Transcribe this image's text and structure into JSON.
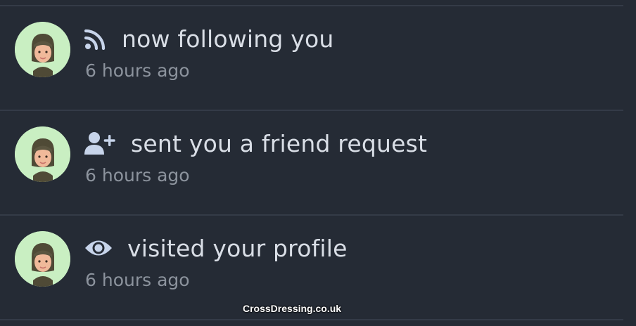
{
  "notifications": [
    {
      "icon": "rss-icon",
      "message": "now following you",
      "time": "6 hours ago"
    },
    {
      "icon": "user-plus-icon",
      "message": "sent you a friend request",
      "time": "6 hours ago"
    },
    {
      "icon": "eye-icon",
      "message": "visited your profile",
      "time": "6 hours ago"
    }
  ],
  "watermark": "CrossDressing.co.uk",
  "colors": {
    "background": "#252b35",
    "divider": "#343b47",
    "avatar_background": "#c9efc2",
    "icon": "#c7d4ea",
    "message_text": "#d9dee6",
    "time_text": "#8c939d"
  }
}
